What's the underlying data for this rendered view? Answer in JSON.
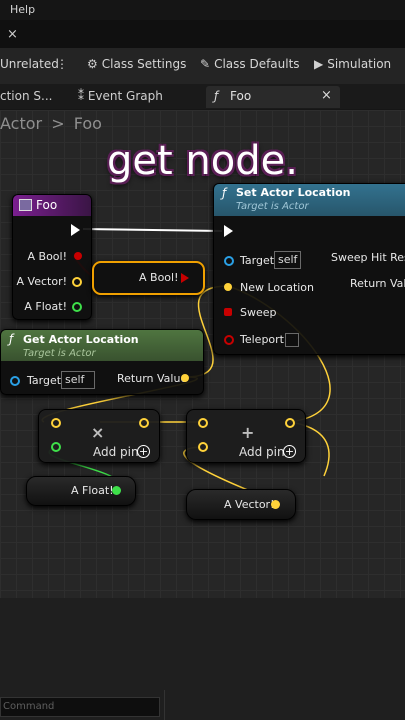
{
  "menu": {
    "help": "Help"
  },
  "tab_close": "×",
  "toolbar": {
    "unrelated": "Unrelated",
    "class_settings": "Class Settings",
    "class_defaults": "Class Defaults",
    "simulation": "Simulation"
  },
  "docktabs": {
    "function": "ction S...",
    "event_graph": "Event Graph",
    "foo": "Foo",
    "close": "×"
  },
  "breadcrumb": {
    "parent": "Actor",
    "sep": ">",
    "current": "Foo"
  },
  "overlay_caption": "get node.",
  "foo_node": {
    "title": "Foo",
    "pins": [
      "A Bool!",
      "A Vector!",
      "A Float!"
    ]
  },
  "get_bool_node": {
    "label": "A Bool!"
  },
  "set_loc_node": {
    "title": "Set Actor Location",
    "subtitle": "Target is Actor",
    "target": "Target",
    "target_value": "self",
    "new_location": "New Location",
    "sweep": "Sweep",
    "teleport": "Teleport",
    "sweep_hit": "Sweep Hit Result",
    "return_value": "Return Value"
  },
  "get_loc_node": {
    "title": "Get Actor Location",
    "subtitle": "Target is Actor",
    "target": "Target",
    "target_value": "self",
    "return_value": "Return Value"
  },
  "mult_node": {
    "symbol": "×",
    "add_pin": "Add pin"
  },
  "add_node": {
    "symbol": "+",
    "add_pin": "Add pin"
  },
  "float_node": {
    "label": "A Float!"
  },
  "vector_node": {
    "label": "A Vector!"
  },
  "command": {
    "placeholder": "Command"
  },
  "colors": {
    "bool": "#c80000",
    "vector": "#ffd23a",
    "float": "#3ee04a",
    "object": "#2aa0e6",
    "exec": "#ffffff",
    "function_header": "#2d5f7a",
    "getter_header": "#3d5a33",
    "event_header": "#6a1a7a"
  }
}
